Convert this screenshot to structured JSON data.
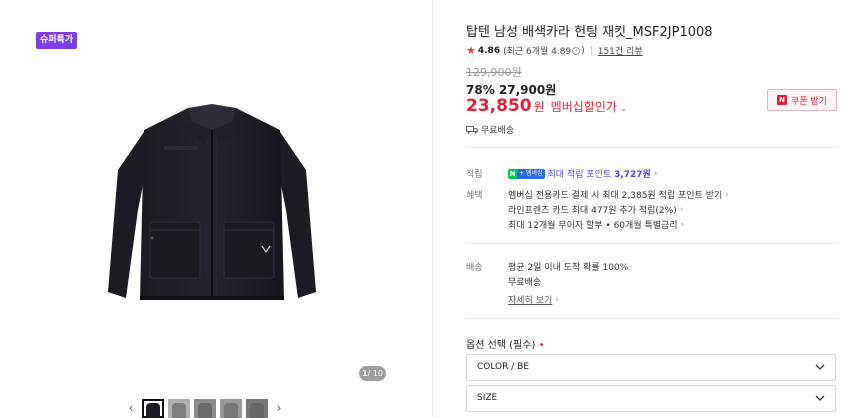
{
  "gallery": {
    "badge": "슈퍼특가",
    "page_current": "1",
    "page_total": "/ 10",
    "prev_arrow": "‹",
    "next_arrow": "›",
    "thumb_count": 5
  },
  "product": {
    "title": "탑텐 남성 배색카라 헌팅 재킷_MSF2JP1008",
    "rating": "4.86",
    "rating_recent": "(최근 6개월 4.89",
    "rating_recent_close": ")",
    "review_count": "151건 리뷰"
  },
  "price": {
    "original": "129,900원",
    "discount_percent": "78%",
    "discounted": "27,900원",
    "member_price": "23,850",
    "member_unit": "원",
    "member_label": "멤버십할인가"
  },
  "shipping_short": "무료배송",
  "coupon": {
    "icon": "N",
    "label": "쿠폰 받기"
  },
  "points": {
    "label": "적립",
    "badge_n": "N",
    "badge_plus": "+ 멤버십",
    "text": "최대 적립 포인트",
    "amount": "3,727원"
  },
  "benefits": {
    "label": "혜택",
    "lines": [
      "멤버십 전용카드 결제 시 최대 2,385원 적립 포인트 받기",
      "라인프렌즈 카드 최대 477원 추가 적립(2%)",
      "최대 12개월 무이자 할부 • 60개월 특별금리"
    ]
  },
  "delivery": {
    "label": "배송",
    "arrival": "평균 2일 이내 도착 확률 100%",
    "fee": "무료배송",
    "detail_link": "자세히 보기"
  },
  "options": {
    "title": "옵션 선택 (필수)",
    "required_mark": "•",
    "selects": [
      {
        "value": "COLOR / BE"
      },
      {
        "value": "SIZE"
      }
    ]
  },
  "colors": {
    "accent_red": "#e0213a",
    "super_badge": "#7b3fe4",
    "point_purple": "#5a3fe0",
    "naver_green": "#03c75a"
  }
}
